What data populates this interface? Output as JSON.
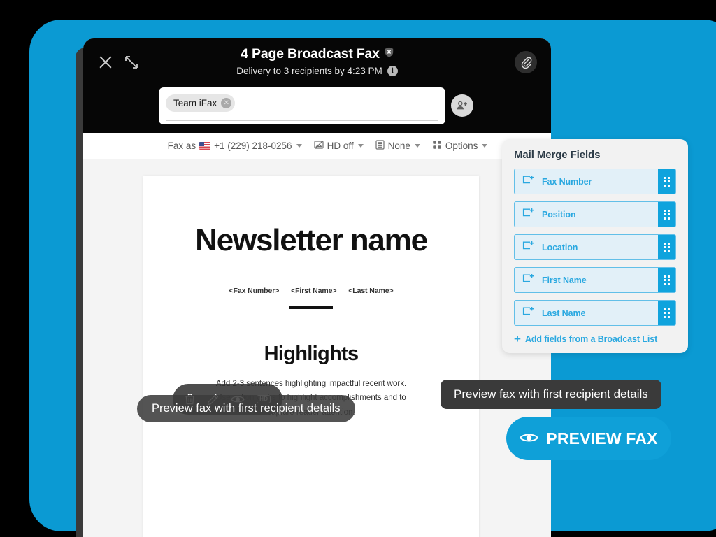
{
  "theme": {
    "brand_blue": "#0b9ad3",
    "cta_blue": "#0fa0d8",
    "field_blue": "#2aa8e0",
    "header_black": "#060606"
  },
  "header": {
    "title": "4 Page Broadcast Fax",
    "security_icon": "shield-off-icon",
    "subtitle": "Delivery to 3 recipients by 4:23 PM",
    "info_icon": "info-icon",
    "info_glyph": "i",
    "close_icon": "close-icon",
    "resize_icon": "resize-icon",
    "attach_icon": "paperclip-icon"
  },
  "recipients": {
    "chips": [
      {
        "label": "Team iFax",
        "remove_glyph": "✕"
      }
    ],
    "placeholder": "",
    "value": "",
    "contacts_icon": "add-contact-icon"
  },
  "toolbar": {
    "items": [
      {
        "id": "fax-as",
        "prefix": "Fax as",
        "icon": "us-flag-icon",
        "label": "+1 (229) 218-0256",
        "caret": true
      },
      {
        "id": "hd",
        "icon": "image-quality-icon",
        "label": "HD off",
        "caret": true
      },
      {
        "id": "cover-page",
        "icon": "cover-page-icon",
        "label": "None",
        "caret": true
      },
      {
        "id": "options",
        "icon": "grid-options-icon",
        "label": "Options",
        "caret": true
      }
    ]
  },
  "document": {
    "title": "Newsletter name",
    "merge_tags": [
      "<Fax Number>",
      "<First Name>",
      "<Last Name>"
    ],
    "section_heading": "Highlights",
    "body_line_1": "Add 2-3 sentences highlighting impactful recent work.",
    "body_line_2": "Use action verbs to highlight accomplishments and to",
    "body_line_3": "capture reader attention."
  },
  "float_toolbar": {
    "buttons": [
      {
        "id": "delete",
        "icon": "trash-icon"
      },
      {
        "id": "edit",
        "icon": "pencil-icon"
      },
      {
        "id": "preview",
        "icon": "eye-icon"
      },
      {
        "id": "hd",
        "icon": "hd-icon",
        "label": "HD"
      }
    ]
  },
  "tooltips": {
    "inner": "Preview fax with first recipient details",
    "outer": "Preview fax with first recipient details"
  },
  "merge_panel": {
    "title": "Mail Merge Fields",
    "fields": [
      {
        "label": "Fax Number",
        "icon": "insert-field-icon",
        "grip": "drag-handle-icon"
      },
      {
        "label": "Position",
        "icon": "insert-field-icon",
        "grip": "drag-handle-icon"
      },
      {
        "label": "Location",
        "icon": "insert-field-icon",
        "grip": "drag-handle-icon"
      },
      {
        "label": "First Name",
        "icon": "insert-field-icon",
        "grip": "drag-handle-icon"
      },
      {
        "label": "Last Name",
        "icon": "insert-field-icon",
        "grip": "drag-handle-icon"
      }
    ],
    "add_link": "Add fields from a Broadcast List",
    "add_glyph": "+"
  },
  "cta": {
    "label": "PREVIEW FAX",
    "icon": "eye-icon"
  }
}
